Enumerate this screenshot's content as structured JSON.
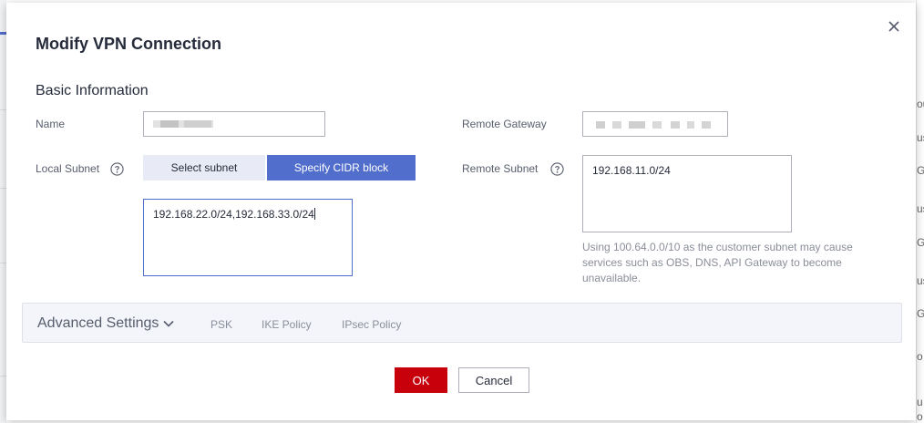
{
  "dialog": {
    "title": "Modify VPN Connection",
    "section_title": "Basic Information"
  },
  "form": {
    "name_label": "Name",
    "name_value": "",
    "local_subnet_label": "Local Subnet",
    "local_subnet_options": [
      "Select subnet",
      "Specify CIDR block"
    ],
    "local_subnet_selected": "Specify CIDR block",
    "local_cidr_value": "192.168.22.0/24,192.168.33.0/24",
    "remote_gateway_label": "Remote Gateway",
    "remote_gateway_value": "",
    "remote_subnet_label": "Remote Subnet",
    "remote_subnet_value": "192.168.11.0/24",
    "remote_subnet_hint": "Using 100.64.0.0/10 as the customer subnet may cause services such as OBS, DNS, API Gateway to become unavailable."
  },
  "advanced": {
    "title": "Advanced Settings",
    "tabs": [
      "PSK",
      "IKE Policy",
      "IPsec Policy"
    ]
  },
  "footer": {
    "ok_label": "OK",
    "cancel_label": "Cancel"
  },
  "background_peek": [
    "ou",
    "us",
    "G",
    "us",
    "G",
    "us",
    "G",
    "o",
    "u",
    "o"
  ],
  "colors": {
    "primary": "#526ecc",
    "danger": "#c7000b",
    "text": "#252b3a",
    "muted": "#8a8e99"
  }
}
